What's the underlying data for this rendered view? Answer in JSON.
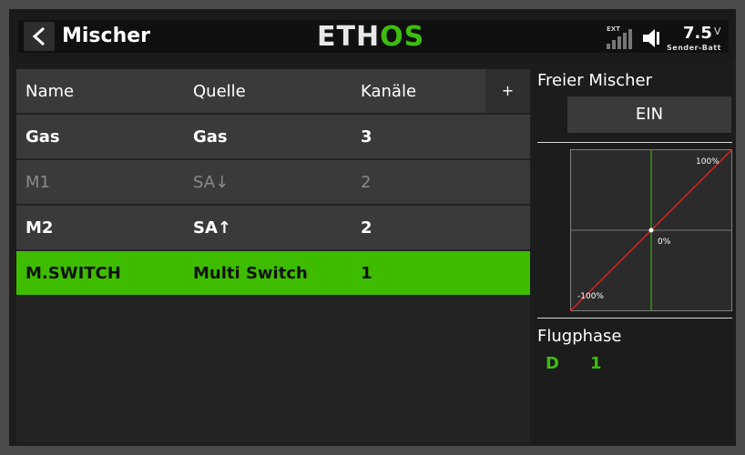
{
  "header": {
    "title": "Mischer",
    "logo_main": "ETH",
    "logo_accent": "OS",
    "signal_label": "EXT",
    "battery_value": "7.5",
    "battery_unit": "V",
    "battery_label": "Sender-Batt"
  },
  "table": {
    "columns": [
      "Name",
      "Quelle",
      "Kanäle"
    ],
    "add_label": "+",
    "rows": [
      {
        "name": "Gas",
        "source": "Gas",
        "channels": "3",
        "state": "normal"
      },
      {
        "name": "M1",
        "source": "SA↓",
        "channels": "2",
        "state": "disabled"
      },
      {
        "name": "M2",
        "source": "SA↑",
        "channels": "2",
        "state": "normal"
      },
      {
        "name": "M.SWITCH",
        "source": "Multi Switch",
        "channels": "1",
        "state": "selected"
      }
    ]
  },
  "side": {
    "free_mixer_label": "Freier Mischer",
    "free_mixer_value": "EIN",
    "curve": {
      "label_max": "100%",
      "label_mid": "0%",
      "label_min": "-100%"
    },
    "flight_phase_label": "Flugphase",
    "flight_phases": [
      "D",
      "1"
    ]
  },
  "colors": {
    "accent": "#3ebc00",
    "curve_line": "#e02020",
    "center_line": "#3ebc10"
  }
}
